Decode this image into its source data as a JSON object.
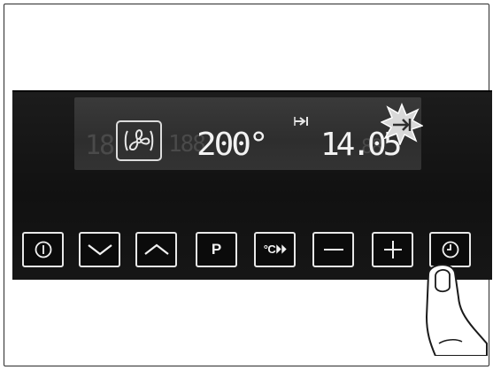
{
  "display": {
    "ghost_left": "18",
    "ghost_mid": "188",
    "ghost_right": "88",
    "temperature": "200°",
    "time": "14.05"
  },
  "icons": {
    "fan": "fan-icon",
    "end_duration": "end-time-arrow-icon",
    "indicator": "flashing-arrow-burst-icon"
  },
  "buttons": [
    {
      "name": "power-button",
      "label": "",
      "icon": "power-icon"
    },
    {
      "name": "down-button",
      "label": "",
      "icon": "chevron-down-icon"
    },
    {
      "name": "up-button",
      "label": "",
      "icon": "chevron-up-icon"
    },
    {
      "name": "program-button",
      "label": "P",
      "icon": ""
    },
    {
      "name": "rapid-heat-button",
      "label": "°C⏵⏵",
      "icon": ""
    },
    {
      "name": "minus-button",
      "label": "—",
      "icon": "minus-icon"
    },
    {
      "name": "plus-button",
      "label": "+",
      "icon": "plus-icon"
    },
    {
      "name": "clock-button",
      "label": "",
      "icon": "clock-icon"
    }
  ],
  "colors": {
    "panel": "#151515",
    "screen": "#333333",
    "segment": "#f2f2f2",
    "button_border": "#e8e8e8"
  }
}
